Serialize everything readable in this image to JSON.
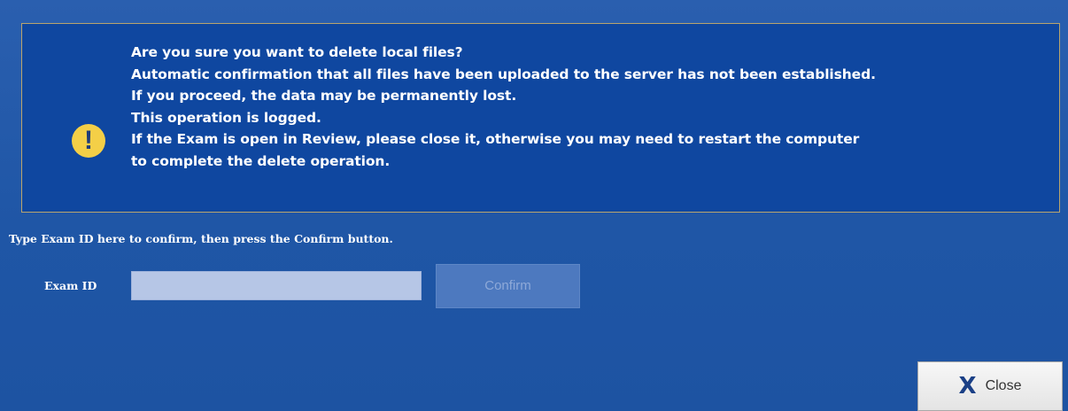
{
  "warning": {
    "icon": "exclamation-icon",
    "lines": [
      "Are you sure you want to delete local files?",
      "Automatic confirmation that all files have been uploaded to the server has not been established.",
      "If you proceed, the data may be permanently lost.",
      "This operation is logged.",
      "If the Exam is open in Review, please close it, otherwise you may need to restart the computer",
      "to complete the delete operation."
    ]
  },
  "form": {
    "instruction": "Type Exam ID here to confirm, then press the Confirm button.",
    "exam_id_label": "Exam ID",
    "exam_id_value": "",
    "confirm_label": "Confirm"
  },
  "footer": {
    "close_label": "Close",
    "close_icon": "close-x-icon"
  },
  "colors": {
    "background": "#2057a8",
    "panel": "#0f47a0",
    "panel_border": "#b9a46e",
    "warning_icon": "#f4cf47",
    "confirm_disabled": "#4d79bf"
  }
}
